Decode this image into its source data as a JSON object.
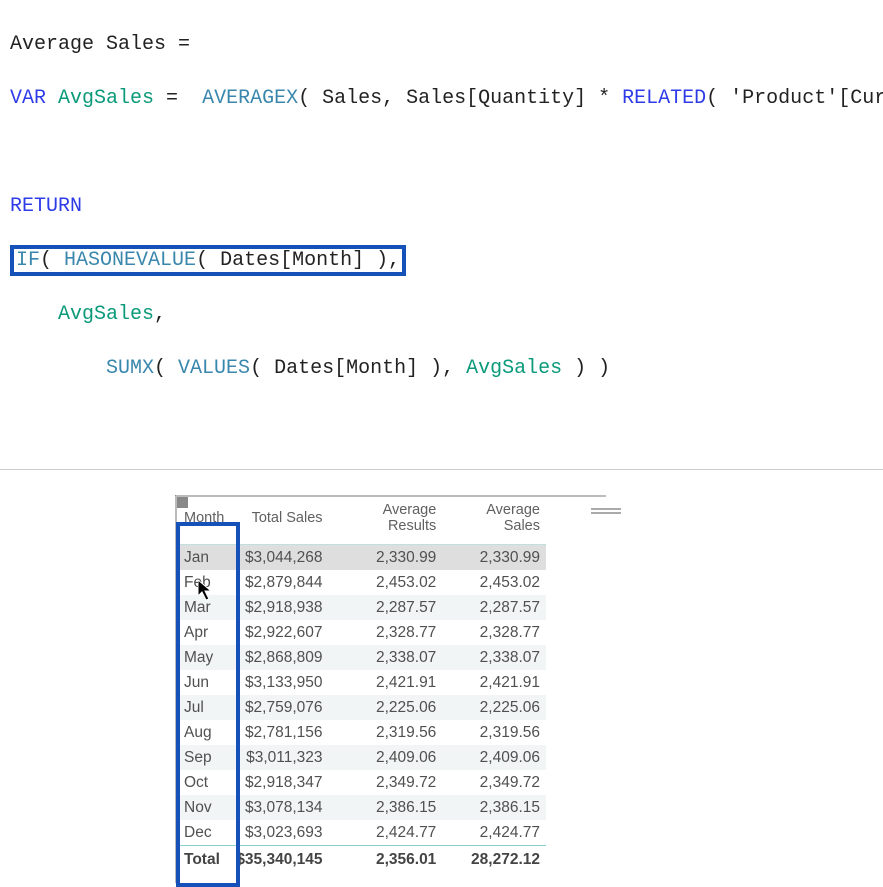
{
  "code": {
    "l1_a": "Average Sales =",
    "l2_a": "VAR",
    "l2_b": " AvgSales",
    "l2_c": " = ",
    "l2_d": " AVERAGEX",
    "l2_e": "( Sales, Sales[Quantity] * ",
    "l2_f": "RELATED",
    "l2_g": "( 'Product'[Current Price] ) )",
    "l3_a": "RETURN",
    "l4_a": "IF",
    "l4_b": "( ",
    "l4_c": "HASONEVALUE",
    "l4_d": "( Dates[Month] ),",
    "l5_a": "    AvgSales",
    "l5_b": ",",
    "l6_a": "        ",
    "l6_b": "SUMX",
    "l6_c": "( ",
    "l6_d": "VALUES",
    "l6_e": "( Dates[Month] ), ",
    "l6_f": "AvgSales",
    "l6_g": " ) )"
  },
  "table": {
    "headers": {
      "c1": "Month",
      "c2": "Total Sales",
      "c3": "Average Results",
      "c4": "Average Sales"
    },
    "rows": [
      {
        "month": "Jan",
        "total": "$3,044,268",
        "avgRes": "2,330.99",
        "avgSales": "2,330.99"
      },
      {
        "month": "Feb",
        "total": "$2,879,844",
        "avgRes": "2,453.02",
        "avgSales": "2,453.02"
      },
      {
        "month": "Mar",
        "total": "$2,918,938",
        "avgRes": "2,287.57",
        "avgSales": "2,287.57"
      },
      {
        "month": "Apr",
        "total": "$2,922,607",
        "avgRes": "2,328.77",
        "avgSales": "2,328.77"
      },
      {
        "month": "May",
        "total": "$2,868,809",
        "avgRes": "2,338.07",
        "avgSales": "2,338.07"
      },
      {
        "month": "Jun",
        "total": "$3,133,950",
        "avgRes": "2,421.91",
        "avgSales": "2,421.91"
      },
      {
        "month": "Jul",
        "total": "$2,759,076",
        "avgRes": "2,225.06",
        "avgSales": "2,225.06"
      },
      {
        "month": "Aug",
        "total": "$2,781,156",
        "avgRes": "2,319.56",
        "avgSales": "2,319.56"
      },
      {
        "month": "Sep",
        "total": "$3,011,323",
        "avgRes": "2,409.06",
        "avgSales": "2,409.06"
      },
      {
        "month": "Oct",
        "total": "$2,918,347",
        "avgRes": "2,349.72",
        "avgSales": "2,349.72"
      },
      {
        "month": "Nov",
        "total": "$3,078,134",
        "avgRes": "2,386.15",
        "avgSales": "2,386.15"
      },
      {
        "month": "Dec",
        "total": "$3,023,693",
        "avgRes": "2,424.77",
        "avgSales": "2,424.77"
      }
    ],
    "total": {
      "month": "Total",
      "total": "$35,340,145",
      "avgRes": "2,356.01",
      "avgSales": "28,272.12"
    }
  }
}
